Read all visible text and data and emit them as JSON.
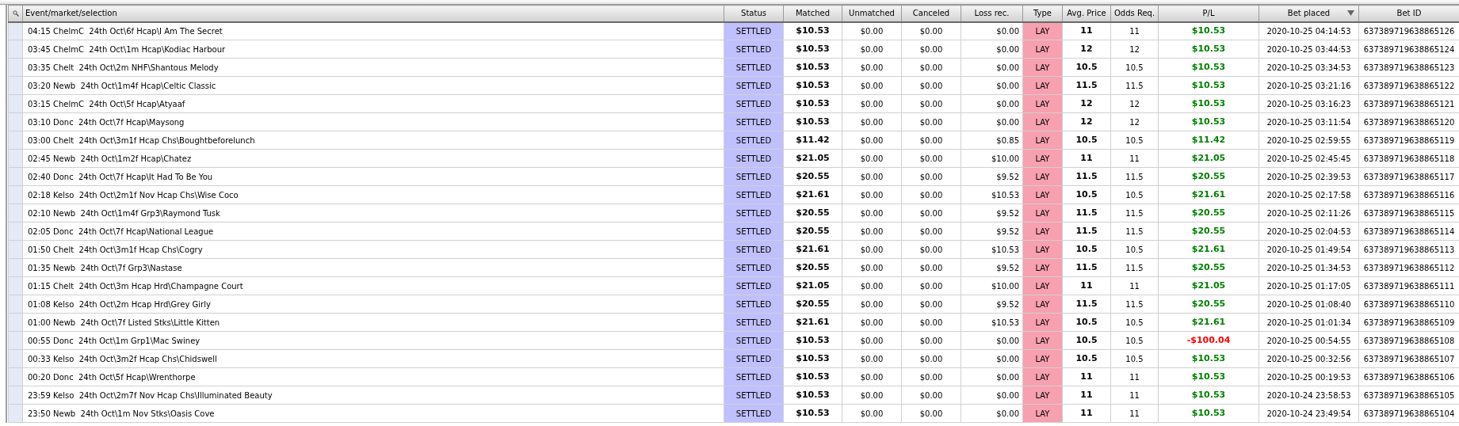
{
  "table": {
    "columns": [
      {
        "label": "Event/market/selection",
        "sorted": false
      },
      {
        "label": "Status",
        "sorted": false
      },
      {
        "label": "Matched",
        "sorted": false
      },
      {
        "label": "Unmatched",
        "sorted": false
      },
      {
        "label": "Canceled",
        "sorted": false
      },
      {
        "label": "Loss rec.",
        "sorted": false
      },
      {
        "label": "Type",
        "sorted": false
      },
      {
        "label": "Avg. Price",
        "sorted": false
      },
      {
        "label": "Odds Req.",
        "sorted": false
      },
      {
        "label": "P/L",
        "sorted": false
      },
      {
        "label": "Bet placed",
        "sorted": true
      },
      {
        "label": "Bet ID",
        "sorted": false
      }
    ],
    "rows": [
      {
        "event": "04:15 ChelmC  24th Oct\\6f Hcap\\I Am The Secret",
        "status": "SETTLED",
        "matched": "$10.53",
        "unmatched": "$0.00",
        "canceled": "$0.00",
        "loss_rec": "$0.00",
        "type": "LAY",
        "avg_price": "11",
        "odds_req": "11",
        "pl": "$10.53",
        "loss": false,
        "bet_placed": "2020-10-25 04:14:53",
        "bet_id": "637389719638865126"
      },
      {
        "event": "03:45 ChelmC  24th Oct\\1m Hcap\\Kodiac Harbour",
        "status": "SETTLED",
        "matched": "$10.53",
        "unmatched": "$0.00",
        "canceled": "$0.00",
        "loss_rec": "$0.00",
        "type": "LAY",
        "avg_price": "12",
        "odds_req": "12",
        "pl": "$10.53",
        "loss": false,
        "bet_placed": "2020-10-25 03:44:53",
        "bet_id": "637389719638865124"
      },
      {
        "event": "03:35 Chelt  24th Oct\\2m NHF\\Shantous Melody",
        "status": "SETTLED",
        "matched": "$10.53",
        "unmatched": "$0.00",
        "canceled": "$0.00",
        "loss_rec": "$0.00",
        "type": "LAY",
        "avg_price": "10.5",
        "odds_req": "10.5",
        "pl": "$10.53",
        "loss": false,
        "bet_placed": "2020-10-25 03:34:53",
        "bet_id": "637389719638865123"
      },
      {
        "event": "03:20 Newb  24th Oct\\1m4f Hcap\\Celtic Classic",
        "status": "SETTLED",
        "matched": "$10.53",
        "unmatched": "$0.00",
        "canceled": "$0.00",
        "loss_rec": "$0.00",
        "type": "LAY",
        "avg_price": "11.5",
        "odds_req": "11.5",
        "pl": "$10.53",
        "loss": false,
        "bet_placed": "2020-10-25 03:21:16",
        "bet_id": "637389719638865122"
      },
      {
        "event": "03:15 ChelmC  24th Oct\\5f Hcap\\Atyaaf",
        "status": "SETTLED",
        "matched": "$10.53",
        "unmatched": "$0.00",
        "canceled": "$0.00",
        "loss_rec": "$0.00",
        "type": "LAY",
        "avg_price": "12",
        "odds_req": "12",
        "pl": "$10.53",
        "loss": false,
        "bet_placed": "2020-10-25 03:16:23",
        "bet_id": "637389719638865121"
      },
      {
        "event": "03:10 Donc  24th Oct\\7f Hcap\\Maysong",
        "status": "SETTLED",
        "matched": "$10.53",
        "unmatched": "$0.00",
        "canceled": "$0.00",
        "loss_rec": "$0.00",
        "type": "LAY",
        "avg_price": "12",
        "odds_req": "12",
        "pl": "$10.53",
        "loss": false,
        "bet_placed": "2020-10-25 03:11:54",
        "bet_id": "637389719638865120"
      },
      {
        "event": "03:00 Chelt  24th Oct\\3m1f Hcap Chs\\Boughtbeforelunch",
        "status": "SETTLED",
        "matched": "$11.42",
        "unmatched": "$0.00",
        "canceled": "$0.00",
        "loss_rec": "$0.85",
        "type": "LAY",
        "avg_price": "10.5",
        "odds_req": "10.5",
        "pl": "$11.42",
        "loss": false,
        "bet_placed": "2020-10-25 02:59:55",
        "bet_id": "637389719638865119"
      },
      {
        "event": "02:45 Newb  24th Oct\\1m2f Hcap\\Chatez",
        "status": "SETTLED",
        "matched": "$21.05",
        "unmatched": "$0.00",
        "canceled": "$0.00",
        "loss_rec": "$10.00",
        "type": "LAY",
        "avg_price": "11",
        "odds_req": "11",
        "pl": "$21.05",
        "loss": false,
        "bet_placed": "2020-10-25 02:45:45",
        "bet_id": "637389719638865118"
      },
      {
        "event": "02:40 Donc  24th Oct\\7f Hcap\\It Had To Be You",
        "status": "SETTLED",
        "matched": "$20.55",
        "unmatched": "$0.00",
        "canceled": "$0.00",
        "loss_rec": "$9.52",
        "type": "LAY",
        "avg_price": "11.5",
        "odds_req": "11.5",
        "pl": "$20.55",
        "loss": false,
        "bet_placed": "2020-10-25 02:39:53",
        "bet_id": "637389719638865117"
      },
      {
        "event": "02:18 Kelso  24th Oct\\2m1f Nov Hcap Chs\\Wise Coco",
        "status": "SETTLED",
        "matched": "$21.61",
        "unmatched": "$0.00",
        "canceled": "$0.00",
        "loss_rec": "$10.53",
        "type": "LAY",
        "avg_price": "10.5",
        "odds_req": "10.5",
        "pl": "$21.61",
        "loss": false,
        "bet_placed": "2020-10-25 02:17:58",
        "bet_id": "637389719638865116"
      },
      {
        "event": "02:10 Newb  24th Oct\\1m4f Grp3\\Raymond Tusk",
        "status": "SETTLED",
        "matched": "$20.55",
        "unmatched": "$0.00",
        "canceled": "$0.00",
        "loss_rec": "$9.52",
        "type": "LAY",
        "avg_price": "11.5",
        "odds_req": "11.5",
        "pl": "$20.55",
        "loss": false,
        "bet_placed": "2020-10-25 02:11:26",
        "bet_id": "637389719638865115"
      },
      {
        "event": "02:05 Donc  24th Oct\\7f Hcap\\National League",
        "status": "SETTLED",
        "matched": "$20.55",
        "unmatched": "$0.00",
        "canceled": "$0.00",
        "loss_rec": "$9.52",
        "type": "LAY",
        "avg_price": "11.5",
        "odds_req": "11.5",
        "pl": "$20.55",
        "loss": false,
        "bet_placed": "2020-10-25 02:04:53",
        "bet_id": "637389719638865114"
      },
      {
        "event": "01:50 Chelt  24th Oct\\3m1f Hcap Chs\\Cogry",
        "status": "SETTLED",
        "matched": "$21.61",
        "unmatched": "$0.00",
        "canceled": "$0.00",
        "loss_rec": "$10.53",
        "type": "LAY",
        "avg_price": "10.5",
        "odds_req": "10.5",
        "pl": "$21.61",
        "loss": false,
        "bet_placed": "2020-10-25 01:49:54",
        "bet_id": "637389719638865113"
      },
      {
        "event": "01:35 Newb  24th Oct\\7f Grp3\\Nastase",
        "status": "SETTLED",
        "matched": "$20.55",
        "unmatched": "$0.00",
        "canceled": "$0.00",
        "loss_rec": "$9.52",
        "type": "LAY",
        "avg_price": "11.5",
        "odds_req": "11.5",
        "pl": "$20.55",
        "loss": false,
        "bet_placed": "2020-10-25 01:34:53",
        "bet_id": "637389719638865112"
      },
      {
        "event": "01:15 Chelt  24th Oct\\3m Hcap Hrd\\Champagne Court",
        "status": "SETTLED",
        "matched": "$21.05",
        "unmatched": "$0.00",
        "canceled": "$0.00",
        "loss_rec": "$10.00",
        "type": "LAY",
        "avg_price": "11",
        "odds_req": "11",
        "pl": "$21.05",
        "loss": false,
        "bet_placed": "2020-10-25 01:17:05",
        "bet_id": "637389719638865111"
      },
      {
        "event": "01:08 Kelso  24th Oct\\2m Hcap Hrd\\Grey Girly",
        "status": "SETTLED",
        "matched": "$20.55",
        "unmatched": "$0.00",
        "canceled": "$0.00",
        "loss_rec": "$9.52",
        "type": "LAY",
        "avg_price": "11.5",
        "odds_req": "11.5",
        "pl": "$20.55",
        "loss": false,
        "bet_placed": "2020-10-25 01:08:40",
        "bet_id": "637389719638865110"
      },
      {
        "event": "01:00 Newb  24th Oct\\7f Listed Stks\\Little Kitten",
        "status": "SETTLED",
        "matched": "$21.61",
        "unmatched": "$0.00",
        "canceled": "$0.00",
        "loss_rec": "$10.53",
        "type": "LAY",
        "avg_price": "10.5",
        "odds_req": "10.5",
        "pl": "$21.61",
        "loss": false,
        "bet_placed": "2020-10-25 01:01:34",
        "bet_id": "637389719638865109"
      },
      {
        "event": "00:55 Donc  24th Oct\\1m Grp1\\Mac Swiney",
        "status": "SETTLED",
        "matched": "$10.53",
        "unmatched": "$0.00",
        "canceled": "$0.00",
        "loss_rec": "$0.00",
        "type": "LAY",
        "avg_price": "10.5",
        "odds_req": "10.5",
        "pl": "-$100.04",
        "loss": true,
        "bet_placed": "2020-10-25 00:54:55",
        "bet_id": "637389719638865108"
      },
      {
        "event": "00:33 Kelso  24th Oct\\3m2f Hcap Chs\\Chidswell",
        "status": "SETTLED",
        "matched": "$10.53",
        "unmatched": "$0.00",
        "canceled": "$0.00",
        "loss_rec": "$0.00",
        "type": "LAY",
        "avg_price": "10.5",
        "odds_req": "10.5",
        "pl": "$10.53",
        "loss": false,
        "bet_placed": "2020-10-25 00:32:56",
        "bet_id": "637389719638865107"
      },
      {
        "event": "00:20 Donc  24th Oct\\5f Hcap\\Wrenthorpe",
        "status": "SETTLED",
        "matched": "$10.53",
        "unmatched": "$0.00",
        "canceled": "$0.00",
        "loss_rec": "$0.00",
        "type": "LAY",
        "avg_price": "11",
        "odds_req": "11",
        "pl": "$10.53",
        "loss": false,
        "bet_placed": "2020-10-25 00:19:53",
        "bet_id": "637389719638865106"
      },
      {
        "event": "23:59 Kelso  24th Oct\\2m7f Nov Hcap Chs\\Illuminated Beauty",
        "status": "SETTLED",
        "matched": "$10.53",
        "unmatched": "$0.00",
        "canceled": "$0.00",
        "loss_rec": "$0.00",
        "type": "LAY",
        "avg_price": "11",
        "odds_req": "11",
        "pl": "$10.53",
        "loss": false,
        "bet_placed": "2020-10-24 23:58:53",
        "bet_id": "637389719638865105"
      },
      {
        "event": "23:50 Newb  24th Oct\\1m Nov Stks\\Oasis Cove",
        "status": "SETTLED",
        "matched": "$10.53",
        "unmatched": "$0.00",
        "canceled": "$0.00",
        "loss_rec": "$0.00",
        "type": "LAY",
        "avg_price": "11",
        "odds_req": "11",
        "pl": "$10.53",
        "loss": false,
        "bet_placed": "2020-10-24 23:49:54",
        "bet_id": "637389719638865104"
      }
    ]
  }
}
